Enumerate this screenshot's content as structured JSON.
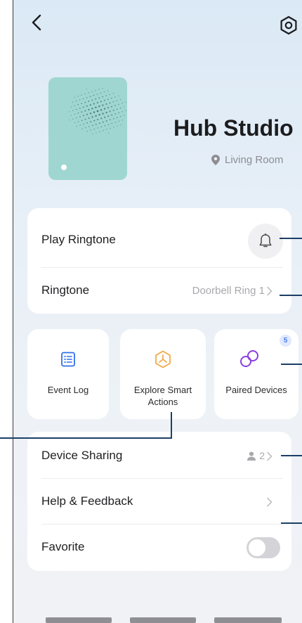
{
  "header": {
    "back_icon": "chevron-left-icon",
    "settings_icon": "hexagon-settings-icon"
  },
  "device": {
    "name": "Hub Studio",
    "location": "Living Room",
    "location_icon": "location-pin-icon"
  },
  "ringtone_card": {
    "play_label": "Play Ringtone",
    "play_icon": "bell-icon",
    "ringtone_label": "Ringtone",
    "ringtone_value": "Doorbell Ring 1"
  },
  "tiles": [
    {
      "label": "Event Log",
      "icon": "event-log-icon",
      "color": "#2f6fea"
    },
    {
      "label": "Explore Smart Actions",
      "icon": "smart-actions-icon",
      "color": "#f2a640"
    },
    {
      "label": "Paired Devices",
      "icon": "paired-devices-icon",
      "color": "#8b3fe0",
      "badge": "5"
    }
  ],
  "settings_card": {
    "sharing_label": "Device Sharing",
    "sharing_count": "2",
    "help_label": "Help & Feedback",
    "favorite_label": "Favorite",
    "favorite_enabled": false
  },
  "colors": {
    "accent_blue": "#2f6fea",
    "thumbnail": "#9fd6d1",
    "callout_line": "#1c3f66"
  }
}
